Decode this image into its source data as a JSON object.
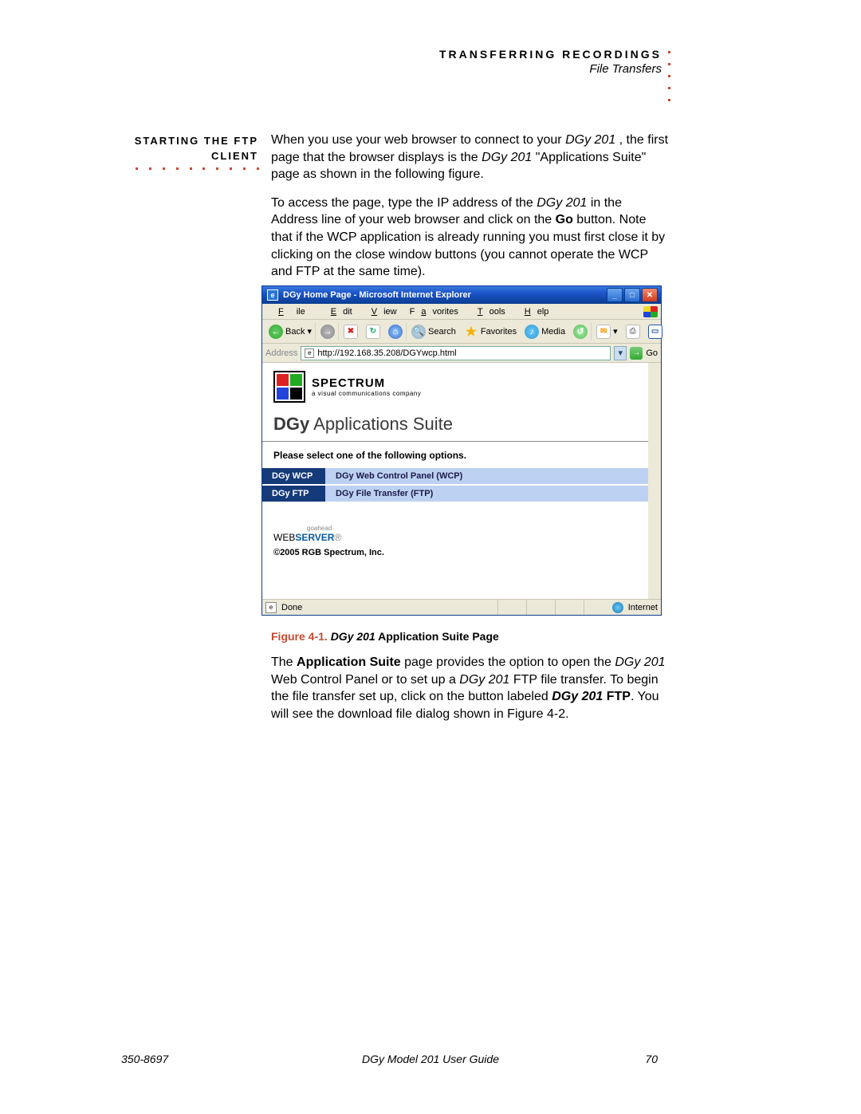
{
  "header": {
    "chapter": "TRANSFERRING RECORDINGS",
    "section": "File Transfers"
  },
  "sidebar_label_line1": "STARTING THE FTP",
  "sidebar_label_line2": "CLIENT",
  "para1": {
    "t1": "When you use your web browser to connect to your ",
    "i1": "DGy 201",
    "t2": " , the first page that the browser displays is the ",
    "i2": "DGy 201",
    "t3": " \"Applications Suite\" page as shown in the following figure."
  },
  "para2": {
    "t1": "To access the page, type the IP address of the ",
    "i1": "DGy 201",
    "t2": " in the Address line of your web browser and click on the ",
    "b1": "Go",
    "t3": " button. Note that if the WCP application is already running you must first close it by clicking on the close window buttons (you cannot operate the WCP and FTP at the same time)."
  },
  "ie": {
    "title": "DGy Home Page - Microsoft Internet Explorer",
    "menu": {
      "file": "File",
      "edit": "Edit",
      "view": "View",
      "fav": "Favorites",
      "tools": "Tools",
      "help": "Help"
    },
    "tb": {
      "back": "Back",
      "search": "Search",
      "favorites": "Favorites",
      "media": "Media"
    },
    "addr_label": "Address",
    "url": "http://192.168.35.208/DGYwcp.html",
    "go": "Go",
    "logo_name": "SPECTRUM",
    "logo_tag": "a visual communications company",
    "app_d": "DGy",
    "app_rest": " Applications Suite",
    "prompt": "Please select one of the following options.",
    "opt1_btn": "DGy WCP",
    "opt1_desc": "DGy Web Control Panel (WCP)",
    "opt2_btn": "DGy FTP",
    "opt2_desc": "DGy File Transfer (FTP)",
    "goahead": "goahead",
    "web": "WEB",
    "server": "SERVER",
    "copyright": "©2005 RGB Spectrum, Inc.",
    "status_done": "Done",
    "status_zone": "Internet"
  },
  "figure": {
    "num": "Figure 4-1.",
    "ital": "DGy 201",
    "rest": " Application Suite Page"
  },
  "para3": {
    "t1": "The ",
    "b1": "Application Suite",
    "t2": " page provides the option to open the ",
    "i1": "DGy 201",
    "t3": " Web Control Panel or to set up a ",
    "i2": "DGy 201",
    "t4": " FTP file transfer. To begin the file transfer set up, click on the button labeled ",
    "bi1": "DGy 201",
    "b2": " FTP",
    "t5": ". You will see the download file dialog shown in Figure 4-2."
  },
  "footer": {
    "left": "350-8697",
    "center": "DGy Model 201 User Guide",
    "right": "70"
  }
}
